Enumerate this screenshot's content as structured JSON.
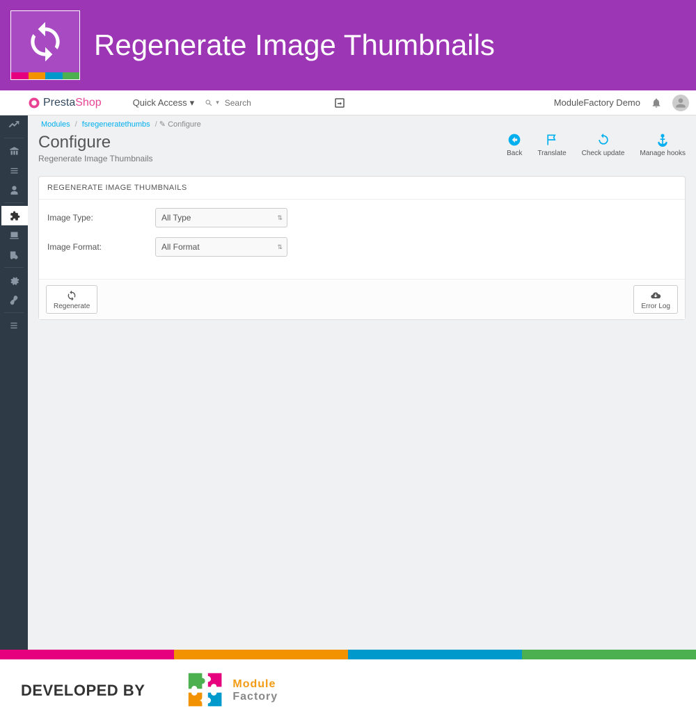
{
  "banner": {
    "title": "Regenerate Image Thumbnails"
  },
  "logo": {
    "p1": "Presta",
    "p2": "Shop"
  },
  "topbar": {
    "quick_access": "Quick Access",
    "search_placeholder": "Search",
    "demo_label": "ModuleFactory Demo"
  },
  "breadcrumb": {
    "a": "Modules",
    "b": "fsregeneratethumbs",
    "c": "Configure"
  },
  "page": {
    "title": "Configure",
    "subtitle": "Regenerate Image Thumbnails"
  },
  "actions": {
    "back": "Back",
    "translate": "Translate",
    "check": "Check update",
    "hooks": "Manage hooks"
  },
  "panel": {
    "heading": "REGENERATE IMAGE THUMBNAILS",
    "type_label": "Image Type:",
    "type_value": "All Type",
    "format_label": "Image Format:",
    "format_value": "All Format",
    "regenerate": "Regenerate",
    "error_log": "Error Log"
  },
  "footer": {
    "dev_by": "Developed by",
    "m": "Module",
    "f": "Factory"
  },
  "colors": {
    "pink": "#e6007e",
    "orange": "#f39200",
    "cyan": "#0099cc",
    "green": "#4caf50"
  }
}
